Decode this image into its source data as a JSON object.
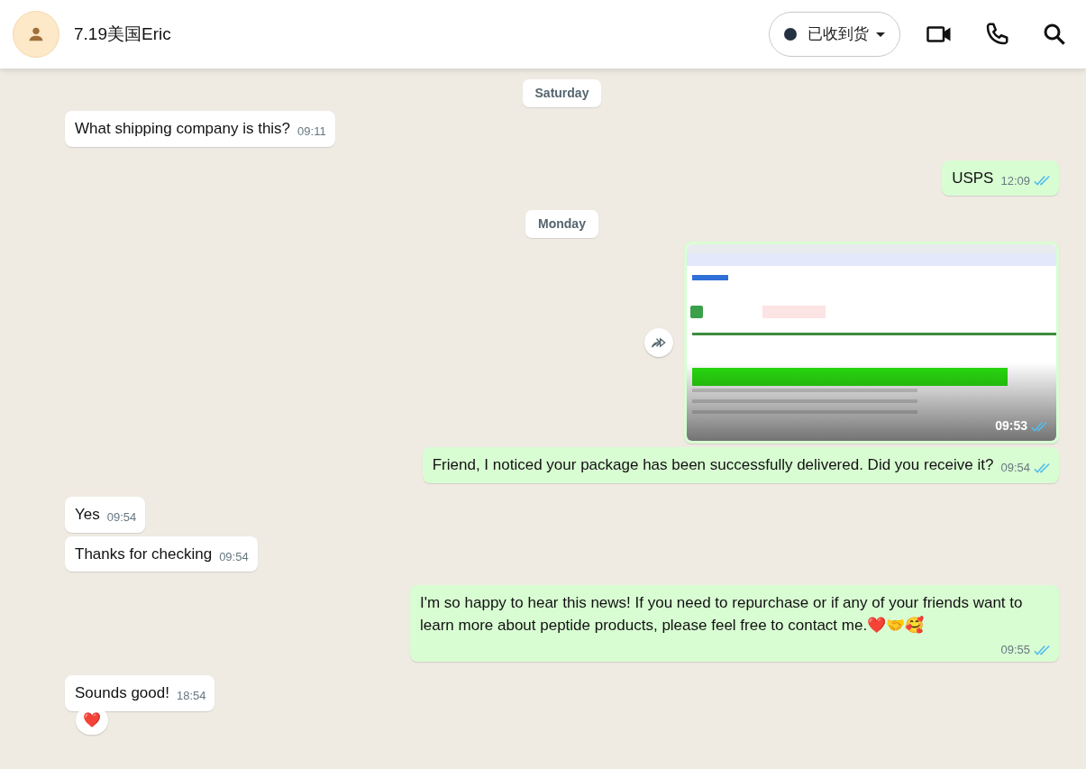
{
  "header": {
    "contact_name": "7.19美国Eric",
    "status_label": "已收到货"
  },
  "messages": [
    {
      "kind": "date",
      "text": "Saturday"
    },
    {
      "kind": "text",
      "outgoing": false,
      "text": "What shipping company is this?",
      "time": "09:11"
    },
    {
      "kind": "text",
      "outgoing": true,
      "text": "USPS",
      "time": "12:09",
      "read": true
    },
    {
      "kind": "date",
      "text": "Monday"
    },
    {
      "outgoing": true,
      "time": "09:53",
      "read": true
    },
    {
      "kind": "text",
      "outgoing": true,
      "text": "Friend, I noticed your package has been successfully delivered. Did you receive it?",
      "time": "09:54",
      "read": true
    },
    {
      "kind": "text",
      "outgoing": false,
      "text": "Yes",
      "time": "09:54"
    },
    {
      "kind": "text",
      "outgoing": false,
      "text": "Thanks for checking",
      "time": "09:54"
    },
    {
      "kind": "text",
      "outgoing": true,
      "text": "I'm so happy to hear this news! If you need to repurchase or if any of your friends want to learn more about peptide products, please feel free to contact me.❤️🤝🥰",
      "time": "09:55",
      "read": true
    },
    {
      "kind": "text",
      "outgoing": false,
      "text": "Sounds good!",
      "time": "18:54",
      "reaction": "❤️"
    }
  ]
}
